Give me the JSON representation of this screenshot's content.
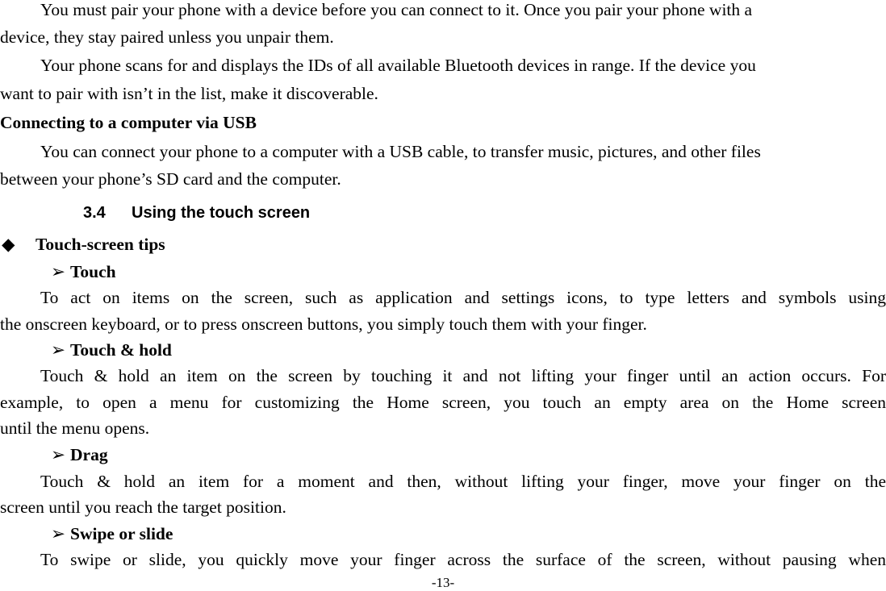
{
  "document": {
    "pairing": {
      "p1": [
        "You must pair your phone with a device before you can connect to it. Once you pair your phone with a",
        "device, they stay paired unless you unpair them."
      ],
      "p2": [
        "Your phone scans for and displays the IDs of all available Bluetooth devices in range. If the device you",
        "want to pair with isn’t in the list, make it discoverable."
      ]
    },
    "usb": {
      "heading": "Connecting to a computer via USB",
      "p": [
        "You can connect your phone to a computer with a USB cable, to transfer music, pictures, and other files",
        "between your phone’s SD card and the computer."
      ]
    },
    "section": {
      "number": "3.4",
      "title": "Using the touch screen"
    },
    "tips": {
      "bullet_icon": "◆",
      "heading": "Touch-screen tips",
      "sub_icon": "➢",
      "items": [
        {
          "title": "Touch",
          "lines": [
            "To act on items on the screen, such as application and settings icons, to type letters and symbols using",
            "the onscreen keyboard, or to press onscreen buttons, you simply touch them with your finger."
          ]
        },
        {
          "title": "Touch & hold",
          "lines": [
            "Touch & hold an item on the screen by touching it and not lifting your finger until an action occurs. For",
            "example, to open a menu for customizing the Home screen, you touch an empty area on the Home screen",
            "until the menu opens."
          ]
        },
        {
          "title": "Drag",
          "lines": [
            "Touch & hold an item for a moment and then, without lifting your finger, move your finger on the",
            "screen until you reach the target position."
          ]
        },
        {
          "title": "Swipe or slide",
          "lines": [
            "To swipe or slide, you quickly move your finger across the surface of the screen, without pausing when"
          ]
        }
      ]
    },
    "page_number": "-13-"
  }
}
